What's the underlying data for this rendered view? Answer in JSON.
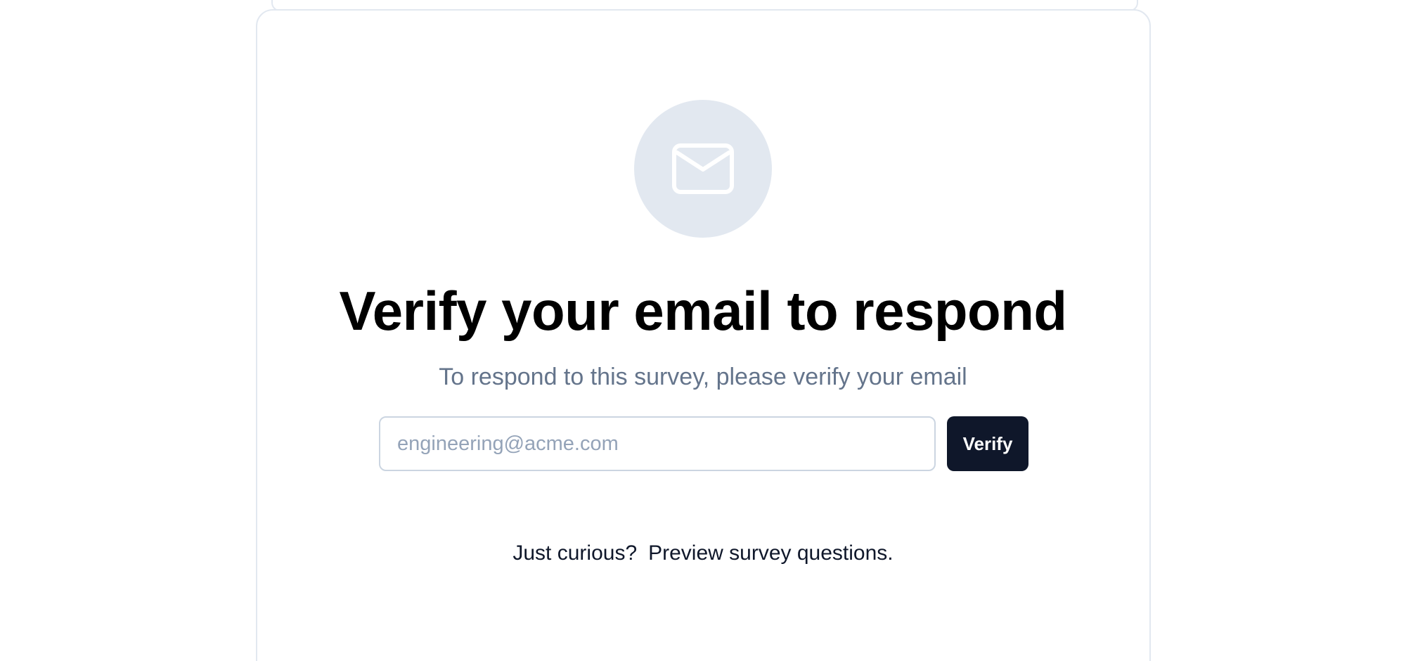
{
  "verify": {
    "title": "Verify your email to respond",
    "subtitle": "To respond to this survey, please verify your email",
    "email_placeholder": "engineering@acme.com",
    "verify_label": "Verify",
    "curious_text": "Just curious?",
    "preview_link": "Preview survey questions."
  },
  "icons": {
    "envelope": "mail-icon"
  },
  "colors": {
    "icon_bg": "#e2e8f0",
    "button_bg": "#0f172a",
    "subtitle": "#64748b",
    "placeholder": "#94a3b8",
    "border": "#cbd5e1"
  }
}
